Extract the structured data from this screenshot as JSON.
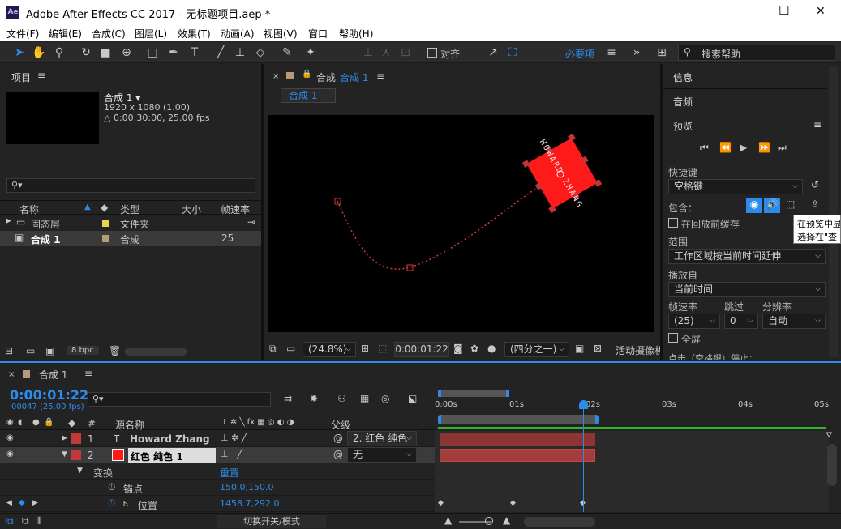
{
  "window": {
    "app_icon": "Ae",
    "title": "Adobe After Effects CC 2017 - 无标题项目.aep *",
    "min": "—",
    "max": "☐",
    "close": "✕"
  },
  "menu": [
    "文件(F)",
    "编辑(E)",
    "合成(C)",
    "图层(L)",
    "效果(T)",
    "动画(A)",
    "视图(V)",
    "窗口",
    "帮助(H)"
  ],
  "toolbar": {
    "snap_label": "对齐",
    "workspace": "必要项",
    "search_placeholder": "搜索帮助"
  },
  "project": {
    "title": "项目",
    "comp_name": "合成 1 ▾",
    "comp_res": "1920 x 1080 (1.00)",
    "comp_dur": "△ 0:00:30:00, 25.00 fps",
    "search_icon": "⚲▾",
    "columns": {
      "name": "名称",
      "type": "类型",
      "size": "大小",
      "fps": "帧速率"
    },
    "items": [
      {
        "name": "固态层",
        "type": "文件夹",
        "fps": "",
        "color": "#e8d44d"
      },
      {
        "name": "合成 1",
        "type": "合成",
        "fps": "25",
        "color": "#b89a7a"
      }
    ],
    "bpc": "8 bpc"
  },
  "composition": {
    "tab_prefix": "合成",
    "tab_name": "合成 1",
    "subtab": "合成 1",
    "zoom": "(24.8%)",
    "timecode": "0:00:01:22",
    "resolution": "(四分之一)",
    "camera": "活动摄像机",
    "text_content": "HOWARD ZHANG"
  },
  "right": {
    "info": "信息",
    "audio": "音频",
    "preview": "预览",
    "shortcut_label": "快捷键",
    "shortcut_value": "空格键",
    "include_label": "包含：",
    "cache_label": "在回放前缓存",
    "range_label": "范围",
    "range_value": "工作区域按当前时间延伸",
    "play_from_label": "播放自",
    "play_from_value": "当前时间",
    "framerate_label": "帧速率",
    "skip_label": "跳过",
    "res_label": "分辨率",
    "framerate_value": "(25)",
    "skip_value": "0",
    "res_value": "自动",
    "fullscreen_label": "全屏",
    "tooltip_line1": "在预览中显",
    "tooltip_line2": "选择在\"查",
    "bottom_cut": "点击（空格键）停止："
  },
  "timeline": {
    "tab_name": "合成 1",
    "timecode": "0:00:01:22",
    "frame_info": "00047 (25.00 fps)",
    "columns": {
      "src": "源名称",
      "parent": "父级",
      "num": "#"
    },
    "layers": [
      {
        "num": "1",
        "type": "T",
        "name": "Howard Zhang",
        "parent": "2. 红色 纯色",
        "color": "#c0393b"
      },
      {
        "num": "2",
        "type": "",
        "name": "红色 纯色 1",
        "parent": "无",
        "color": "#c0393b"
      }
    ],
    "transform_label": "变换",
    "reset_label": "重置",
    "anchor_label": "锚点",
    "anchor_value": "150.0,150.0",
    "position_label": "位置",
    "position_value": "1458.7,292.0",
    "ruler": [
      "0:00s",
      "01s",
      "02s",
      "03s",
      "04s",
      "05s"
    ],
    "toggle_label": "切换开关/模式"
  }
}
